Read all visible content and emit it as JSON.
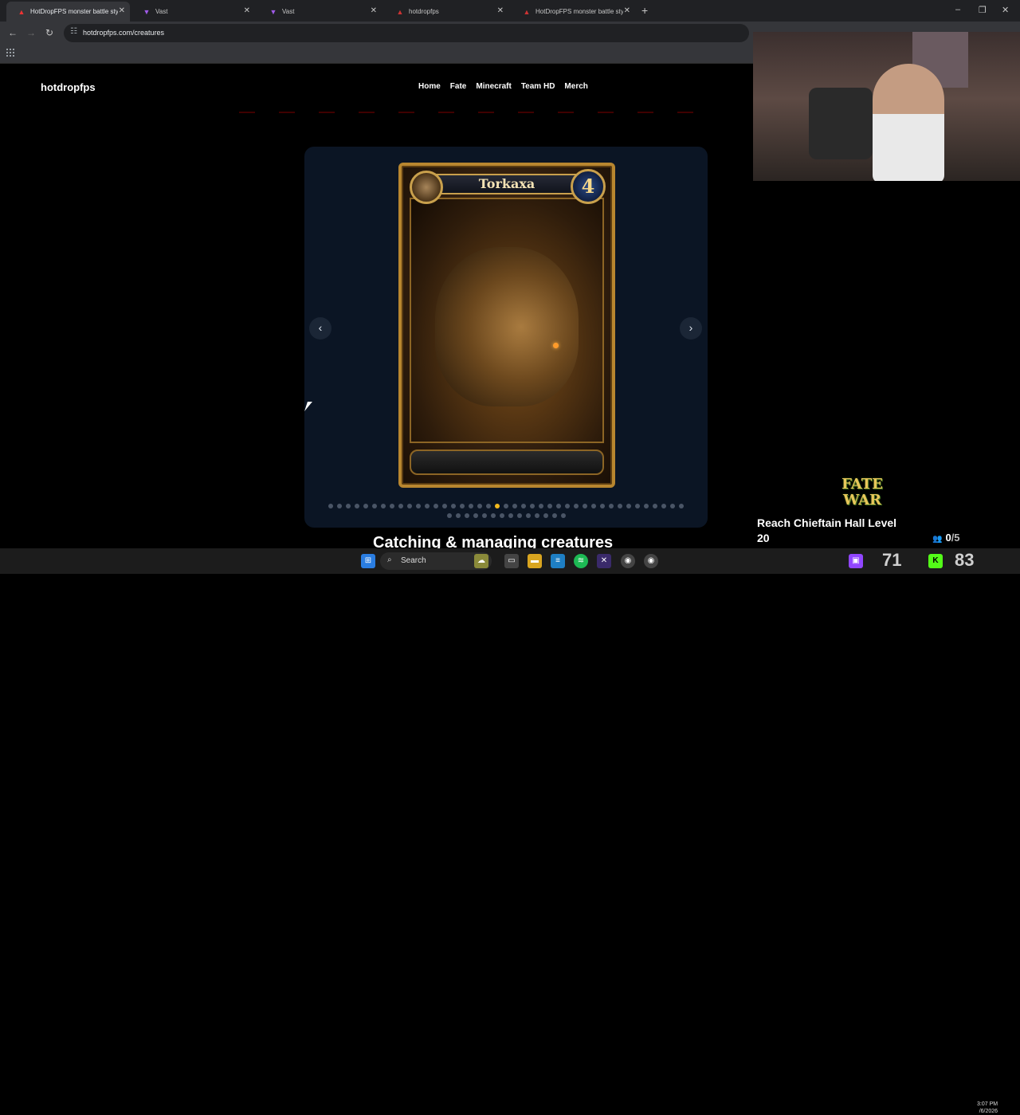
{
  "browser": {
    "tabs": [
      {
        "title": "HotDropFPS monster battle style",
        "active": true
      },
      {
        "title": "Vast",
        "active": false
      },
      {
        "title": "Vast",
        "active": false
      },
      {
        "title": "hotdropfps",
        "active": false
      },
      {
        "title": "HotDropFPS monster battle style",
        "active": false
      }
    ],
    "new_tab": "+",
    "url": "hotdropfps.com/creatures",
    "window_controls": {
      "minimize": "–",
      "restore": "❐",
      "close": "✕"
    }
  },
  "site": {
    "logo": "hotdropfps",
    "nav": [
      "Home",
      "Fate",
      "Minecraft",
      "Team HD",
      "Merch"
    ],
    "carousel": {
      "card": {
        "name": "Torkaxa",
        "cost": "4"
      },
      "prev_label": "‹",
      "next_label": "›",
      "dots_row1": 41,
      "dots_row2": 14,
      "active_dot": 19
    },
    "section_heading": "Catching & managing creatures"
  },
  "stream_overlay": {
    "fate_logo": "FATE WAR",
    "goal_text": "Reach Chieftain Hall Level 20",
    "goal_progress": "0",
    "goal_total": "/5",
    "stat_twitch": "71",
    "stat_kick": "83"
  },
  "taskbar": {
    "search_label": "Search",
    "time": "3:07 PM",
    "date": "/6/2026"
  },
  "colors": {
    "accent_dot": "#f2b91e",
    "carousel_bg": "#0b1524",
    "card_frame": "#b8862f"
  }
}
